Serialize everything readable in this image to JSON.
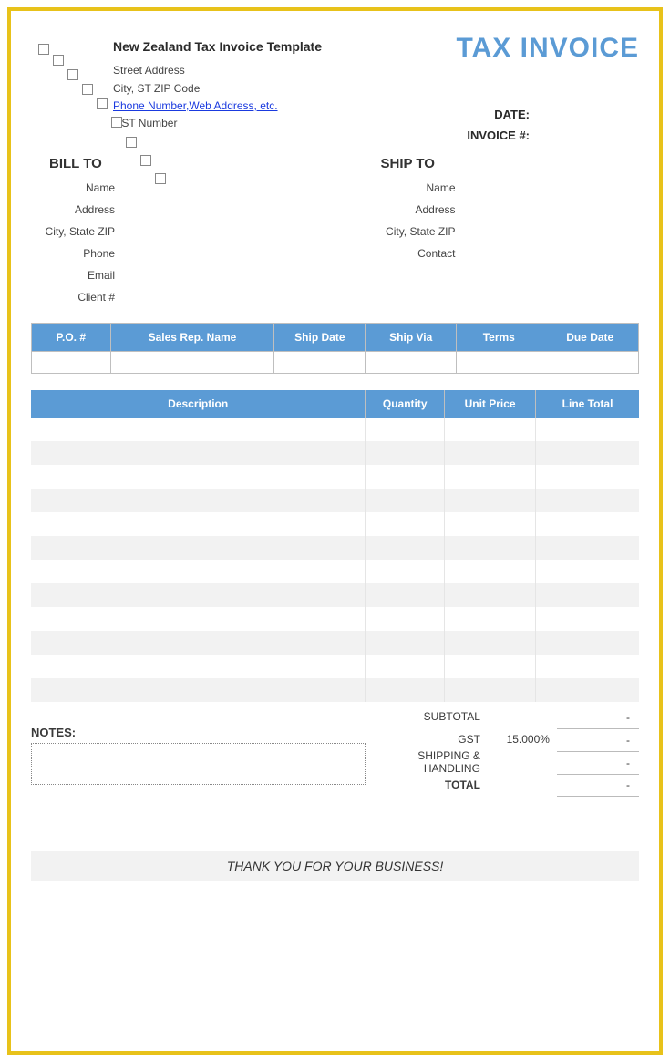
{
  "header": {
    "company_name": "New Zealand Tax Invoice Template",
    "street": "Street Address",
    "city_state_zip": "City, ST  ZIP Code",
    "contact_link": "Phone Number,Web Address, etc.",
    "gst": "GST Number",
    "title": "TAX INVOICE"
  },
  "meta": {
    "date_label": "DATE:",
    "invoice_label": "INVOICE #:"
  },
  "bill_to": {
    "title": "BILL TO",
    "rows": {
      "name": "Name",
      "address": "Address",
      "city": "City, State ZIP",
      "phone": "Phone",
      "email": "Email",
      "client": "Client #"
    }
  },
  "ship_to": {
    "title": "SHIP TO",
    "rows": {
      "name": "Name",
      "address": "Address",
      "city": "City, State ZIP",
      "contact": "Contact"
    }
  },
  "ref_headers": {
    "po": "P.O. #",
    "rep": "Sales Rep. Name",
    "ship_date": "Ship Date",
    "ship_via": "Ship Via",
    "terms": "Terms",
    "due": "Due Date"
  },
  "item_headers": {
    "desc": "Description",
    "qty": "Quantity",
    "price": "Unit Price",
    "total": "Line Total"
  },
  "totals": {
    "subtotal_label": "SUBTOTAL",
    "subtotal_val": "-",
    "gst_label": "GST",
    "gst_pct": "15.000%",
    "gst_val": "-",
    "ship_label": "SHIPPING & HANDLING",
    "ship_val": "-",
    "total_label": "TOTAL",
    "total_val": "-"
  },
  "notes_label": "NOTES:",
  "footer": "THANK YOU FOR YOUR BUSINESS!"
}
